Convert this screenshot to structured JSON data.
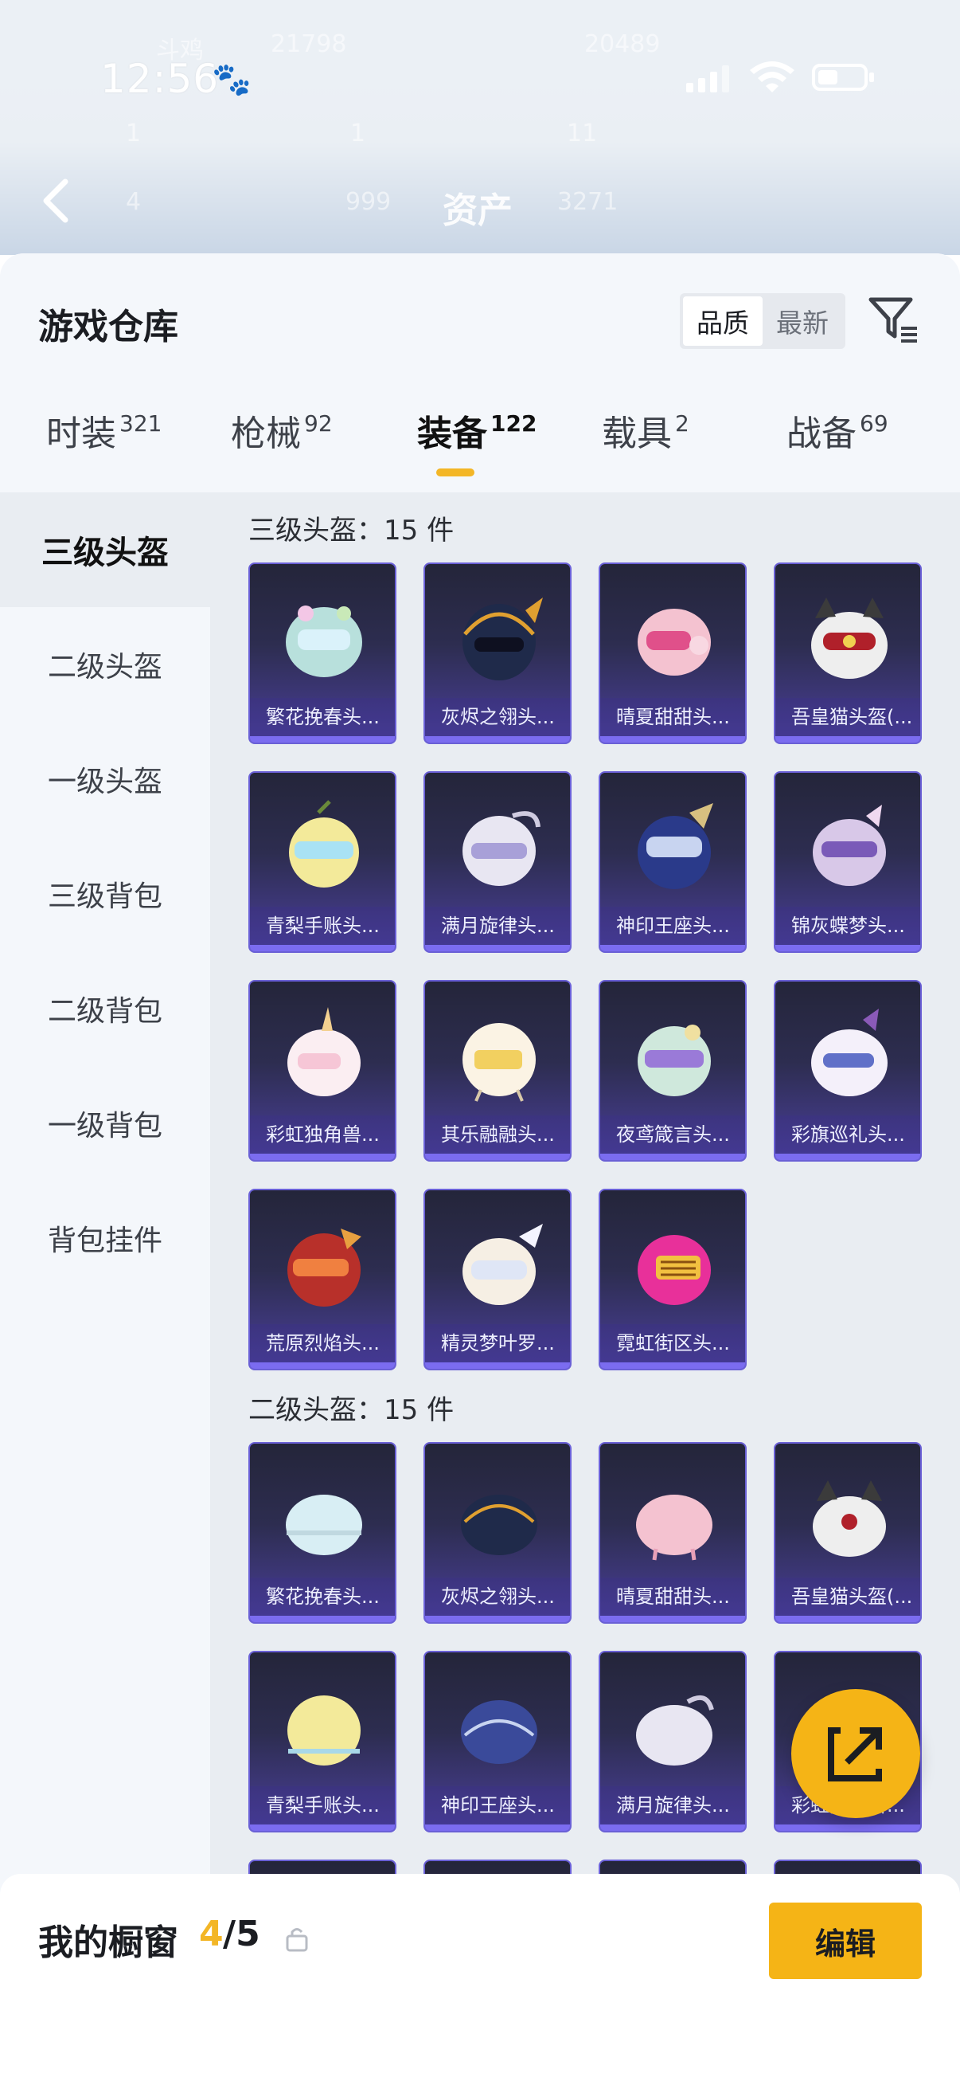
{
  "status_bar": {
    "time": "12:56"
  },
  "background_ghost": {
    "row1": [
      "斗鸡",
      "21798",
      "20489"
    ],
    "row2": [
      "1",
      "1",
      "11"
    ],
    "row3": [
      "4",
      "999",
      "3271"
    ]
  },
  "top_bar": {
    "title": "资产"
  },
  "header": {
    "title": "游戏仓库",
    "sort_options": [
      "品质",
      "最新"
    ],
    "active_sort": "品质"
  },
  "tabs": [
    {
      "label": "时装",
      "count": "321"
    },
    {
      "label": "枪械",
      "count": "92"
    },
    {
      "label": "装备",
      "count": "122"
    },
    {
      "label": "载具",
      "count": "2"
    },
    {
      "label": "战备",
      "count": "69"
    }
  ],
  "sidebar": [
    "三级头盔",
    "二级头盔",
    "一级头盔",
    "三级背包",
    "二级背包",
    "一级背包",
    "背包挂件"
  ],
  "sections": [
    {
      "title": "三级头盔：15 件",
      "items": [
        "繁花挽春头...",
        "灰烬之翎头...",
        "晴夏甜甜头...",
        "吾皇猫头盔(...",
        "青梨手账头...",
        "满月旋律头...",
        "神印王座头...",
        "锦灰蝶梦头...",
        "彩虹独角兽...",
        "其乐融融头...",
        "夜鸢箴言头...",
        "彩旗巡礼头...",
        "荒原烈焰头...",
        "精灵梦叶罗...",
        "霓虹街区头..."
      ]
    },
    {
      "title": "二级头盔：15 件",
      "items": [
        "繁花挽春头...",
        "灰烬之翎头...",
        "晴夏甜甜头...",
        "吾皇猫头盔(...",
        "青梨手账头...",
        "神印王座头...",
        "满月旋律头...",
        "彩虹独角兽..."
      ]
    }
  ],
  "bottom": {
    "label": "我的橱窗",
    "current": "4",
    "total": "/5",
    "edit_label": "编辑"
  },
  "colors": {
    "accent": "#f5b416",
    "card_border": "#6a60d6"
  }
}
